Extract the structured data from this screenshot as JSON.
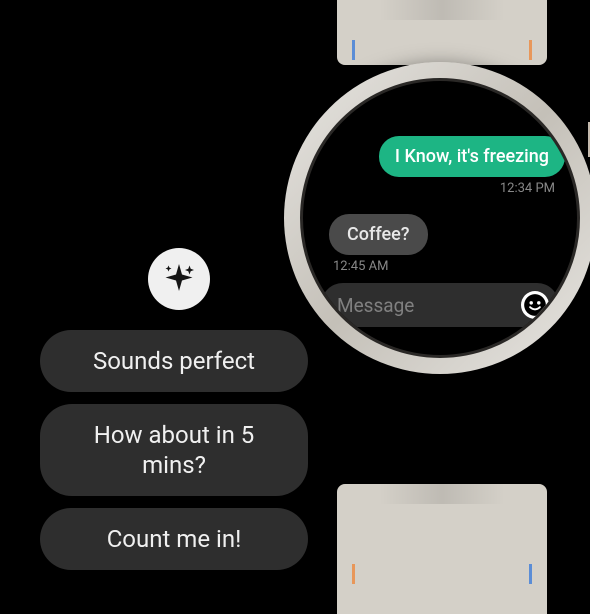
{
  "conversation": {
    "outgoing": {
      "text": "I Know, it's freezing",
      "time": "12:34 PM"
    },
    "incoming": {
      "text": "Coffee?",
      "time": "12:45 AM"
    }
  },
  "input": {
    "placeholder": "Message"
  },
  "suggestions": [
    {
      "label": "Sounds perfect"
    },
    {
      "label": "How about in 5 mins?"
    },
    {
      "label": "Count me in!"
    }
  ]
}
